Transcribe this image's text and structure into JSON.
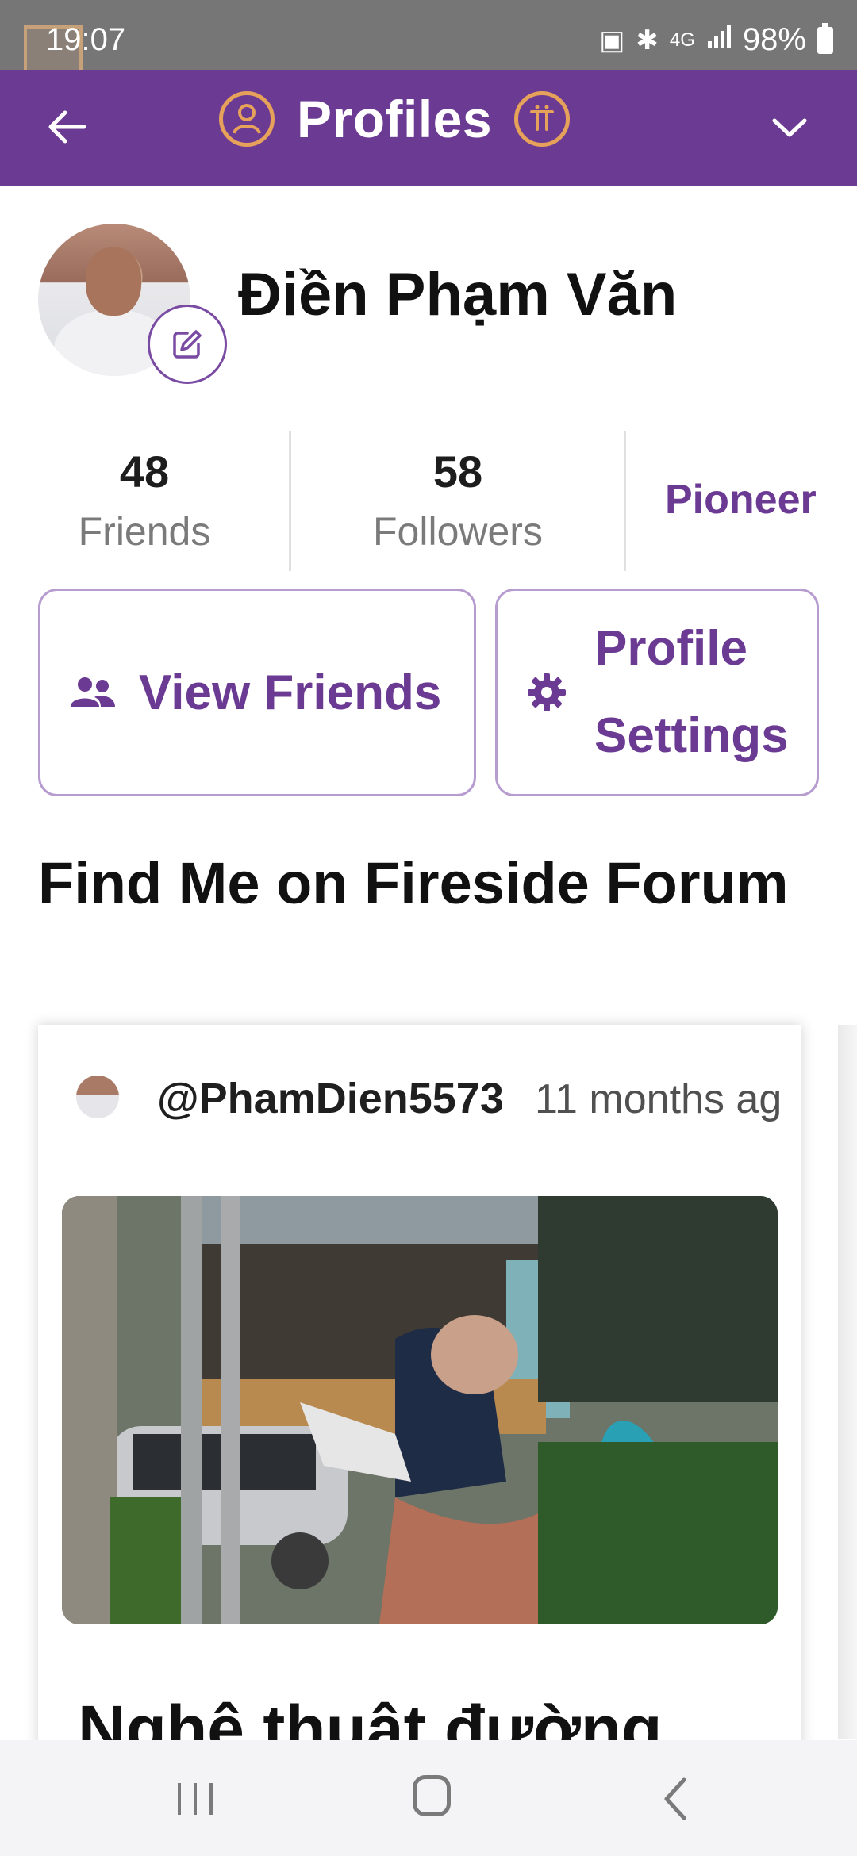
{
  "status_bar": {
    "time": "19:07",
    "network": "4G",
    "battery": "98%"
  },
  "header": {
    "title": "Profiles"
  },
  "profile": {
    "name": "Điền Phạm Văn"
  },
  "stats": {
    "friends_count": "48",
    "friends_label": "Friends",
    "followers_count": "58",
    "followers_label": "Followers",
    "role": "Pioneer"
  },
  "actions": {
    "view_friends": "View Friends",
    "profile_settings_line1": "Profile",
    "profile_settings_line2": "Settings"
  },
  "section": {
    "title": "Find Me on Fireside Forum"
  },
  "post": {
    "handle": "@PhamDien5573",
    "time": "11 months ag",
    "title": "Nghệ thuật đường"
  },
  "colors": {
    "brand_purple": "#6b3a93",
    "accent_orange": "#e6a15a",
    "border_lilac": "#b79cd0"
  }
}
